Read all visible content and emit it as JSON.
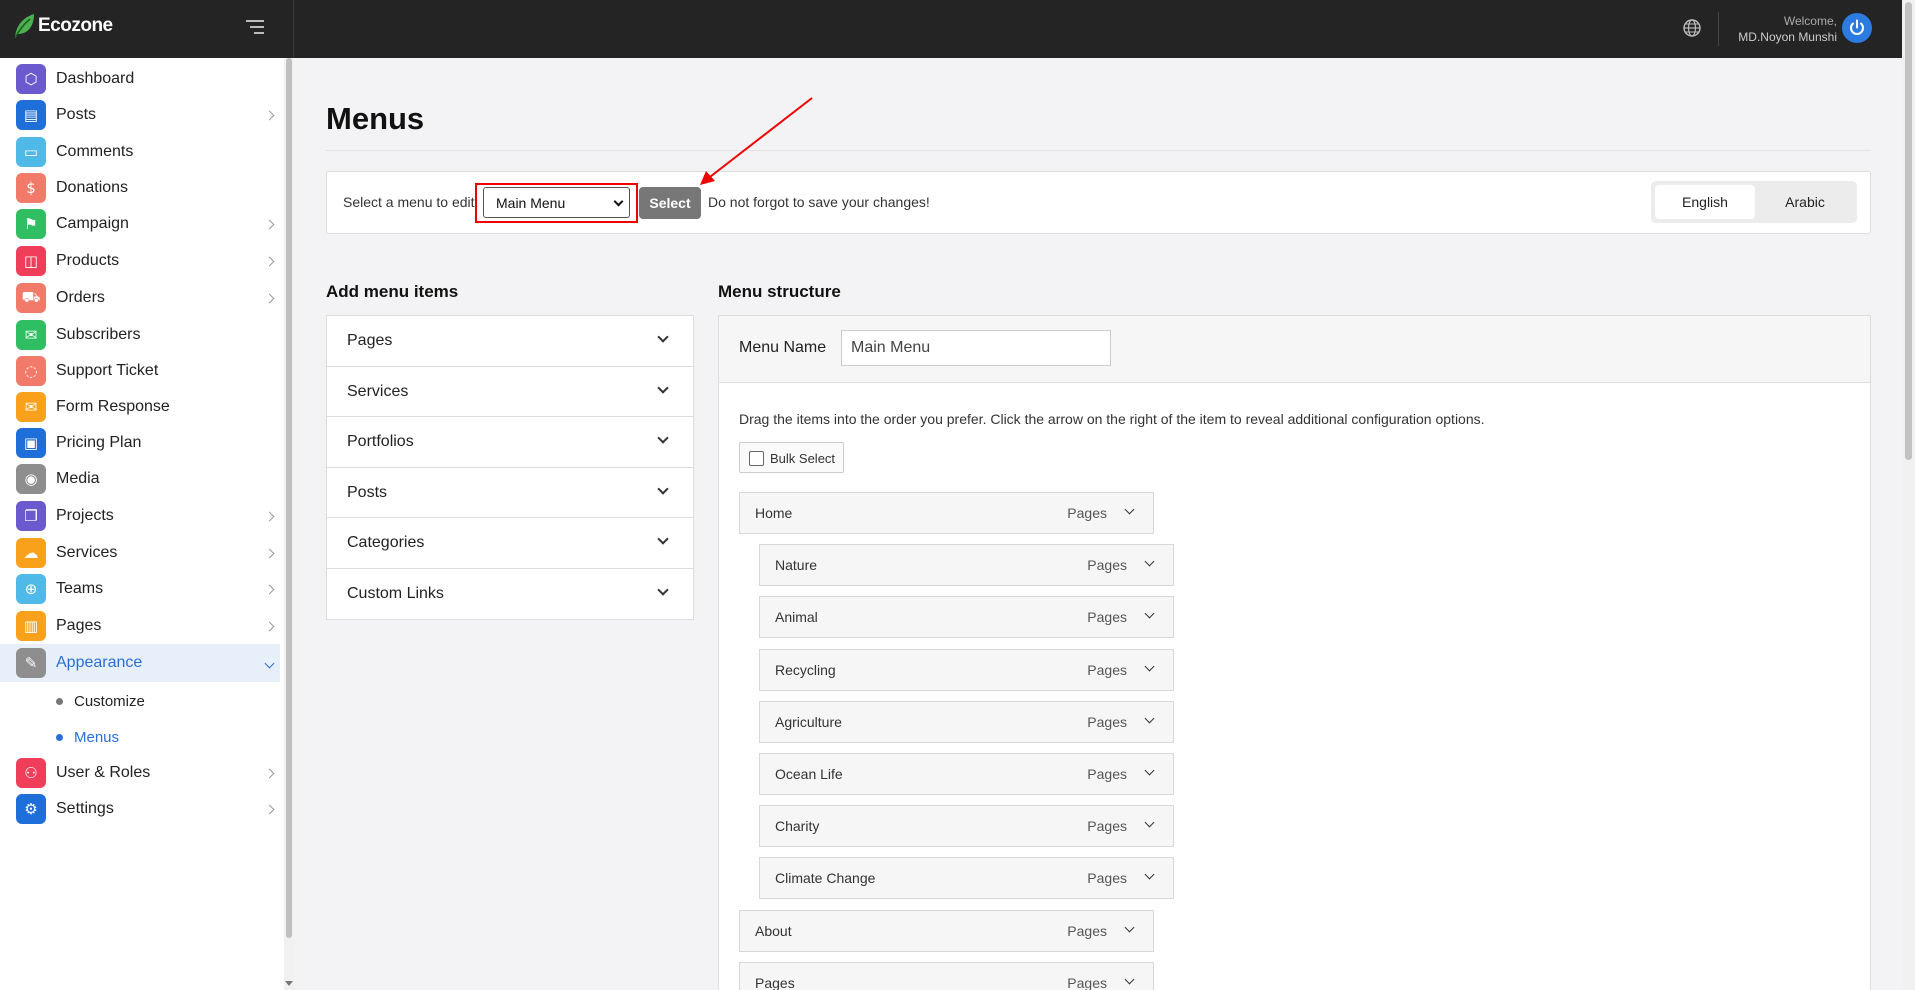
{
  "app": {
    "logo_text": "Ecozone"
  },
  "header": {
    "welcome_label": "Welcome,",
    "user_name": "MD.Noyon Munshi"
  },
  "sidebar": {
    "items": [
      {
        "label": "Dashboard",
        "icon": "cube-icon",
        "color": "#6a5acd",
        "has_children": false
      },
      {
        "label": "Posts",
        "icon": "newspaper-icon",
        "color": "#1e6fd9",
        "has_children": true
      },
      {
        "label": "Comments",
        "icon": "chat-icon",
        "color": "#4fb9e8",
        "has_children": false
      },
      {
        "label": "Donations",
        "icon": "money-bag-icon",
        "color": "#f27a6a",
        "has_children": false
      },
      {
        "label": "Campaign",
        "icon": "campaign-icon",
        "color": "#2fbf62",
        "has_children": true
      },
      {
        "label": "Products",
        "icon": "bag-icon",
        "color": "#f03e5a",
        "has_children": true
      },
      {
        "label": "Orders",
        "icon": "cart-icon",
        "color": "#f27a6a",
        "has_children": true
      },
      {
        "label": "Subscribers",
        "icon": "mail-open-icon",
        "color": "#2fbf62",
        "has_children": false
      },
      {
        "label": "Support Ticket",
        "icon": "support-chat-icon",
        "color": "#f27a6a",
        "has_children": false
      },
      {
        "label": "Form Response",
        "icon": "mail-icon",
        "color": "#f9a11b",
        "has_children": false
      },
      {
        "label": "Pricing Plan",
        "icon": "banknote-icon",
        "color": "#1e6fd9",
        "has_children": false
      },
      {
        "label": "Media",
        "icon": "camera-icon",
        "color": "#8e8e8e",
        "has_children": false
      },
      {
        "label": "Projects",
        "icon": "copy-icon",
        "color": "#6a5acd",
        "has_children": true
      },
      {
        "label": "Services",
        "icon": "cloud-icon",
        "color": "#f9a11b",
        "has_children": true
      },
      {
        "label": "Teams",
        "icon": "plus-circle-icon",
        "color": "#4fb9e8",
        "has_children": true
      },
      {
        "label": "Pages",
        "icon": "inbox-icon",
        "color": "#f9a11b",
        "has_children": true
      },
      {
        "label": "Appearance",
        "icon": "brush-icon",
        "color": "#8e8e8e",
        "has_children": true,
        "active": true
      },
      {
        "label": "User & Roles",
        "icon": "users-icon",
        "color": "#f03e5a",
        "has_children": true
      },
      {
        "label": "Settings",
        "icon": "gear-icon",
        "color": "#1e6fd9",
        "has_children": true
      }
    ],
    "sub_items": [
      {
        "label": "Customize",
        "active": false
      },
      {
        "label": "Menus",
        "active": true
      }
    ]
  },
  "page": {
    "title": "Menus",
    "select_label": "Select a menu to edit:",
    "selected_menu": "Main Menu",
    "select_button": "Select",
    "save_note": "Do not forgot to save your changes!",
    "languages": [
      "English",
      "Arabic"
    ],
    "active_language": "English"
  },
  "add_items": {
    "heading": "Add menu items",
    "sections": [
      "Pages",
      "Services",
      "Portfolios",
      "Posts",
      "Categories",
      "Custom Links"
    ]
  },
  "structure": {
    "heading": "Menu structure",
    "name_label": "Menu Name",
    "name_value": "Main Menu",
    "help_text": "Drag the items into the order you prefer. Click the arrow on the right of the item to reveal additional configuration options.",
    "bulk_label": "Bulk Select",
    "items": [
      {
        "label": "Home",
        "type": "Pages",
        "depth": 0
      },
      {
        "label": "Nature",
        "type": "Pages",
        "depth": 1
      },
      {
        "label": "Animal",
        "type": "Pages",
        "depth": 1
      },
      {
        "label": "Recycling",
        "type": "Pages",
        "depth": 1
      },
      {
        "label": "Agriculture",
        "type": "Pages",
        "depth": 1
      },
      {
        "label": "Ocean Life",
        "type": "Pages",
        "depth": 1
      },
      {
        "label": "Charity",
        "type": "Pages",
        "depth": 1
      },
      {
        "label": "Climate Change",
        "type": "Pages",
        "depth": 1
      },
      {
        "label": "About",
        "type": "Pages",
        "depth": 0
      },
      {
        "label": "Pages",
        "type": "Pages",
        "depth": 0
      }
    ]
  }
}
